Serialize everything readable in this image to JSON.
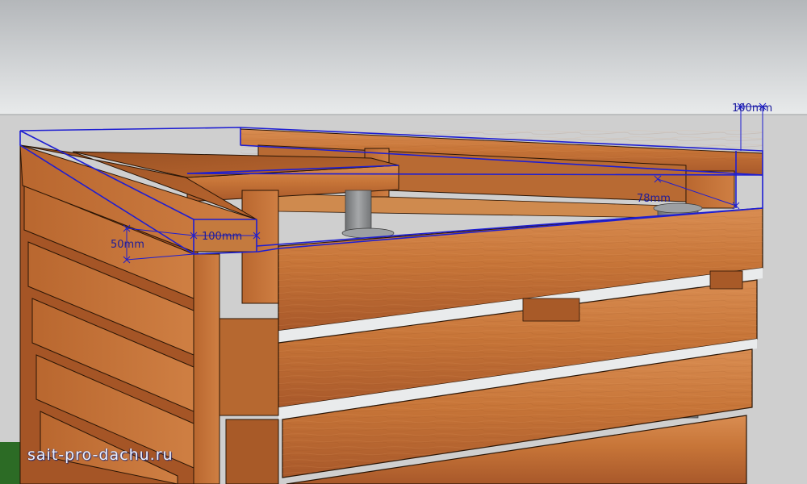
{
  "model": {
    "dimensions": [
      {
        "label": "100mm"
      },
      {
        "label": "78mm"
      },
      {
        "label": "100mm"
      },
      {
        "label": "50mm"
      }
    ]
  },
  "watermark": {
    "text": "sait-pro-dachu.ru"
  },
  "colors": {
    "sky_top": "#b4b7ba",
    "sky_bottom": "#e7e9ea",
    "ground": "#cfcfcf",
    "wood_light": "#d3844a",
    "wood_dark": "#8a4618",
    "pipe": "#8f9192",
    "selection": "#1e1ed2",
    "grass": "#2c6b25"
  }
}
